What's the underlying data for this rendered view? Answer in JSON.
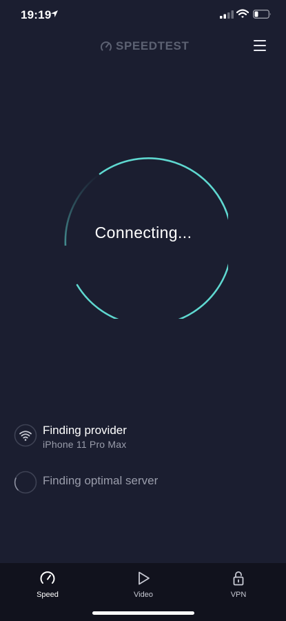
{
  "status_bar": {
    "time": "19:19"
  },
  "header": {
    "brand": "SPEEDTEST"
  },
  "main": {
    "status_text": "Connecting..."
  },
  "steps": {
    "provider": {
      "title": "Finding provider",
      "subtitle": "iPhone 11 Pro Max"
    },
    "server": {
      "title": "Finding optimal server"
    }
  },
  "tabs": [
    {
      "label": "Speed",
      "icon": "speedometer-icon",
      "active": true
    },
    {
      "label": "Video",
      "icon": "play-icon",
      "active": false
    },
    {
      "label": "VPN",
      "icon": "lock-icon",
      "active": false
    }
  ],
  "colors": {
    "background": "#1b1e30",
    "accent": "#5fd8d0",
    "tab_bar": "#11121d"
  }
}
